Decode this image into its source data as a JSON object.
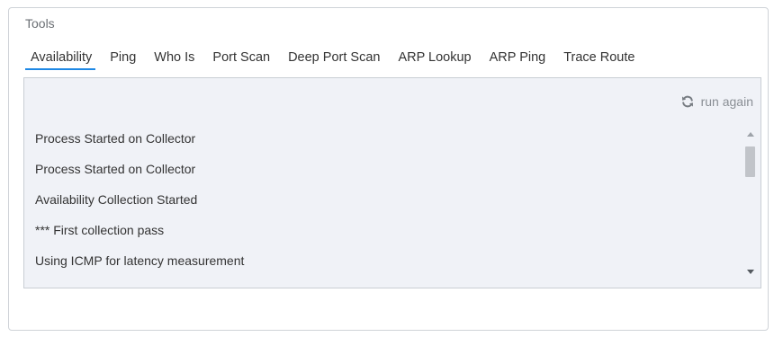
{
  "panel": {
    "title": "Tools"
  },
  "tabs": [
    {
      "label": "Availability",
      "active": true
    },
    {
      "label": "Ping",
      "active": false
    },
    {
      "label": "Who Is",
      "active": false
    },
    {
      "label": "Port Scan",
      "active": false
    },
    {
      "label": "Deep Port Scan",
      "active": false
    },
    {
      "label": "ARP Lookup",
      "active": false
    },
    {
      "label": "ARP Ping",
      "active": false
    },
    {
      "label": "Trace Route",
      "active": false
    }
  ],
  "output": {
    "run_again_label": "run again",
    "run_again_icon": "refresh-icon",
    "lines": [
      "Process Started on Collector",
      "Process Started on Collector",
      "Availability Collection Started",
      "*** First collection pass",
      "Using ICMP for latency measurement"
    ]
  },
  "colors": {
    "accent": "#1e88e5",
    "output_background": "#f0f2f7",
    "border": "#cfd3d8"
  }
}
